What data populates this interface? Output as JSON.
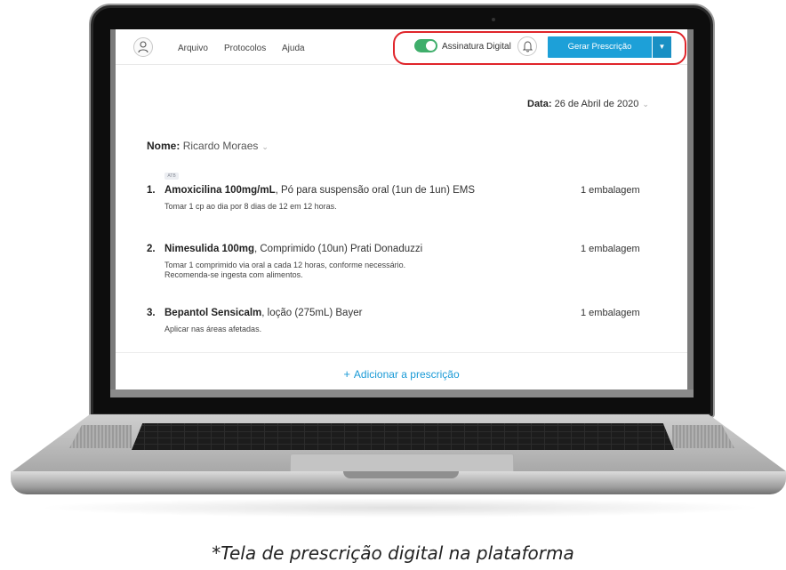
{
  "header": {
    "nav": [
      "Arquivo",
      "Protocolos",
      "Ajuda"
    ],
    "signature_label": "Assinatura Digital",
    "signature_enabled": true,
    "generate_button": "Gerar Prescrição",
    "dropdown_arrow": "▼"
  },
  "prescription": {
    "date_label": "Data:",
    "date_value": "26 de Abril de 2020",
    "name_label": "Nome:",
    "name_value": "Ricardo Moraes",
    "tag": "ATB",
    "items": [
      {
        "number": "1.",
        "drug": "Amoxicilina 100mg/mL",
        "details": ", Pó para suspensão oral (1un de 1un) EMS",
        "quantity": "1 embalagem",
        "instructions": [
          "Tomar 1 cp ao dia por 8 dias de 12 em 12 horas."
        ]
      },
      {
        "number": "2.",
        "drug": "Nimesulida 100mg",
        "details": ", Comprimido (10un) Prati Donaduzzi",
        "quantity": "1 embalagem",
        "instructions": [
          "Tomar 1 comprimido via oral a cada 12 horas, conforme necessário.",
          "Recomenda-se ingesta com alimentos."
        ]
      },
      {
        "number": "3.",
        "drug": "Bepantol Sensicalm",
        "details": ", loção (275mL) Bayer",
        "quantity": "1 embalagem",
        "instructions": [
          "Aplicar nas áreas afetadas."
        ]
      }
    ],
    "add_label": "Adicionar a prescrição",
    "add_icon": "+"
  },
  "icons": {
    "user": "user-icon",
    "bell": "bell-icon",
    "chevron": "chevron-down-icon"
  },
  "colors": {
    "accent": "#1da0d8",
    "toggle_on": "#3fae6b",
    "highlight": "#e0252b"
  },
  "caption": "*Tela de prescrição digital na plataforma"
}
